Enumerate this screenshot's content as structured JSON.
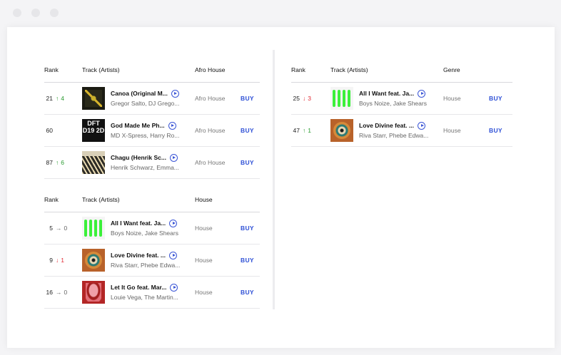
{
  "colors": {
    "accent": "#2d4fd6",
    "up": "#2a9b30",
    "down": "#e22b35"
  },
  "left_top": {
    "headers": {
      "rank": "Rank",
      "track": "Track (Artists)",
      "genre": "Afro House"
    },
    "rows": [
      {
        "rank": "21",
        "dir": "up",
        "arrow": "↑",
        "change": "4",
        "title": "Canoa (Original M...",
        "artists": "Gregor Salto, DJ Grego...",
        "genre": "Afro House",
        "buy": "BUY",
        "art": "canoa"
      },
      {
        "rank": "60",
        "dir": "none",
        "arrow": "",
        "change": "",
        "title": "God Made Me Ph...",
        "artists": "MD X-Spress, Harry Ro...",
        "genre": "Afro House",
        "buy": "BUY",
        "art": "god"
      },
      {
        "rank": "87",
        "dir": "up",
        "arrow": "↑",
        "change": "6",
        "title": "Chagu (Henrik Sc...",
        "artists": "Henrik Schwarz, Emma...",
        "genre": "Afro House",
        "buy": "BUY",
        "art": "chagu"
      }
    ]
  },
  "left_bottom": {
    "headers": {
      "rank": "Rank",
      "track": "Track (Artists)",
      "genre": "House"
    },
    "rows": [
      {
        "rank": "5",
        "dir": "same",
        "arrow": "→",
        "change": "0",
        "title": "All I Want feat. Ja...",
        "artists": "Boys Noize, Jake Shears",
        "genre": "House",
        "buy": "BUY",
        "art": "all"
      },
      {
        "rank": "9",
        "dir": "down",
        "arrow": "↓",
        "change": "1",
        "title": "Love Divine feat. ...",
        "artists": "Riva Starr, Phebe Edwa...",
        "genre": "House",
        "buy": "BUY",
        "art": "love"
      },
      {
        "rank": "16",
        "dir": "same",
        "arrow": "→",
        "change": "0",
        "title": "Let It Go feat. Mar...",
        "artists": "Louie Vega, The Martin...",
        "genre": "House",
        "buy": "BUY",
        "art": "let"
      }
    ]
  },
  "right": {
    "headers": {
      "rank": "Rank",
      "track": "Track (Artists)",
      "genre": "Genre"
    },
    "rows": [
      {
        "rank": "25",
        "dir": "down",
        "arrow": "↓",
        "change": "3",
        "title": "All I Want feat. Ja...",
        "artists": "Boys Noize, Jake Shears",
        "genre": "House",
        "buy": "BUY",
        "art": "all"
      },
      {
        "rank": "47",
        "dir": "up",
        "arrow": "↑",
        "change": "1",
        "title": "Love Divine feat. ...",
        "artists": "Riva Starr, Phebe Edwa...",
        "genre": "House",
        "buy": "BUY",
        "art": "love"
      }
    ]
  },
  "artwork_text": {
    "god": "DFT D19 2D"
  }
}
